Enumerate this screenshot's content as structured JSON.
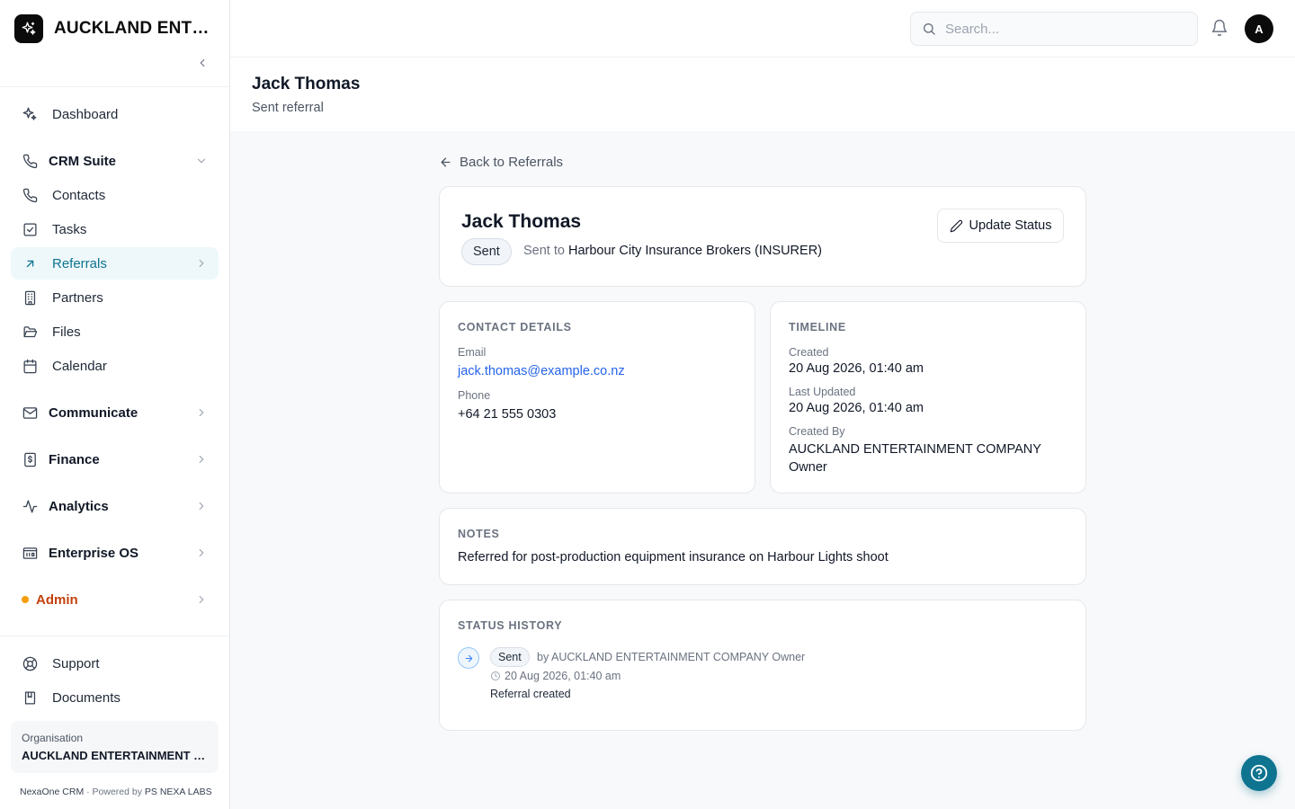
{
  "app": {
    "brand": "AUCKLAND ENTERTAINMENT COMPANY",
    "accent_color": "#0e7490"
  },
  "sidebar": {
    "dashboard": "Dashboard",
    "crm_group": "CRM Suite",
    "crm_items": [
      "Contacts",
      "Tasks",
      "Referrals",
      "Partners",
      "Files",
      "Calendar"
    ],
    "active_item": "Referrals",
    "groups": [
      "Communicate",
      "Finance",
      "Analytics",
      "Enterprise OS"
    ],
    "admin": "Admin",
    "bottom": [
      "Support",
      "Documents"
    ],
    "org_label": "Organisation",
    "org_name": "AUCKLAND ENTERTAINMENT COMPANY",
    "footer_product": "NexaOne CRM",
    "footer_sep": "·",
    "footer_powered": "Powered by",
    "footer_company": "PS NEXA LABS"
  },
  "topbar": {
    "search_placeholder": "Search...",
    "avatar_initial": "A"
  },
  "header": {
    "title": "Jack Thomas",
    "subtitle": "Sent referral"
  },
  "referral": {
    "back_label": "Back to Referrals",
    "name": "Jack Thomas",
    "status": "Sent",
    "sent_to_prefix": "Sent to",
    "sent_to": "Harbour City Insurance Brokers (INSURER)",
    "update_button": "Update Status"
  },
  "contact": {
    "title": "Contact Details",
    "email_label": "Email",
    "email": "jack.thomas@example.co.nz",
    "phone_label": "Phone",
    "phone": "+64 21 555 0303"
  },
  "timeline": {
    "title": "Timeline",
    "created_label": "Created",
    "created": "20 Aug 2026, 01:40 am",
    "updated_label": "Last Updated",
    "updated": "20 Aug 2026, 01:40 am",
    "created_by_label": "Created By",
    "created_by": "AUCKLAND ENTERTAINMENT COMPANY Owner"
  },
  "notes": {
    "title": "Notes",
    "text": "Referred for post-production equipment insurance on Harbour Lights shoot"
  },
  "history": {
    "title": "Status History",
    "entries": [
      {
        "status": "Sent",
        "by": "by AUCKLAND ENTERTAINMENT COMPANY Owner",
        "time": "20 Aug 2026, 01:40 am",
        "note": "Referral created"
      }
    ]
  }
}
